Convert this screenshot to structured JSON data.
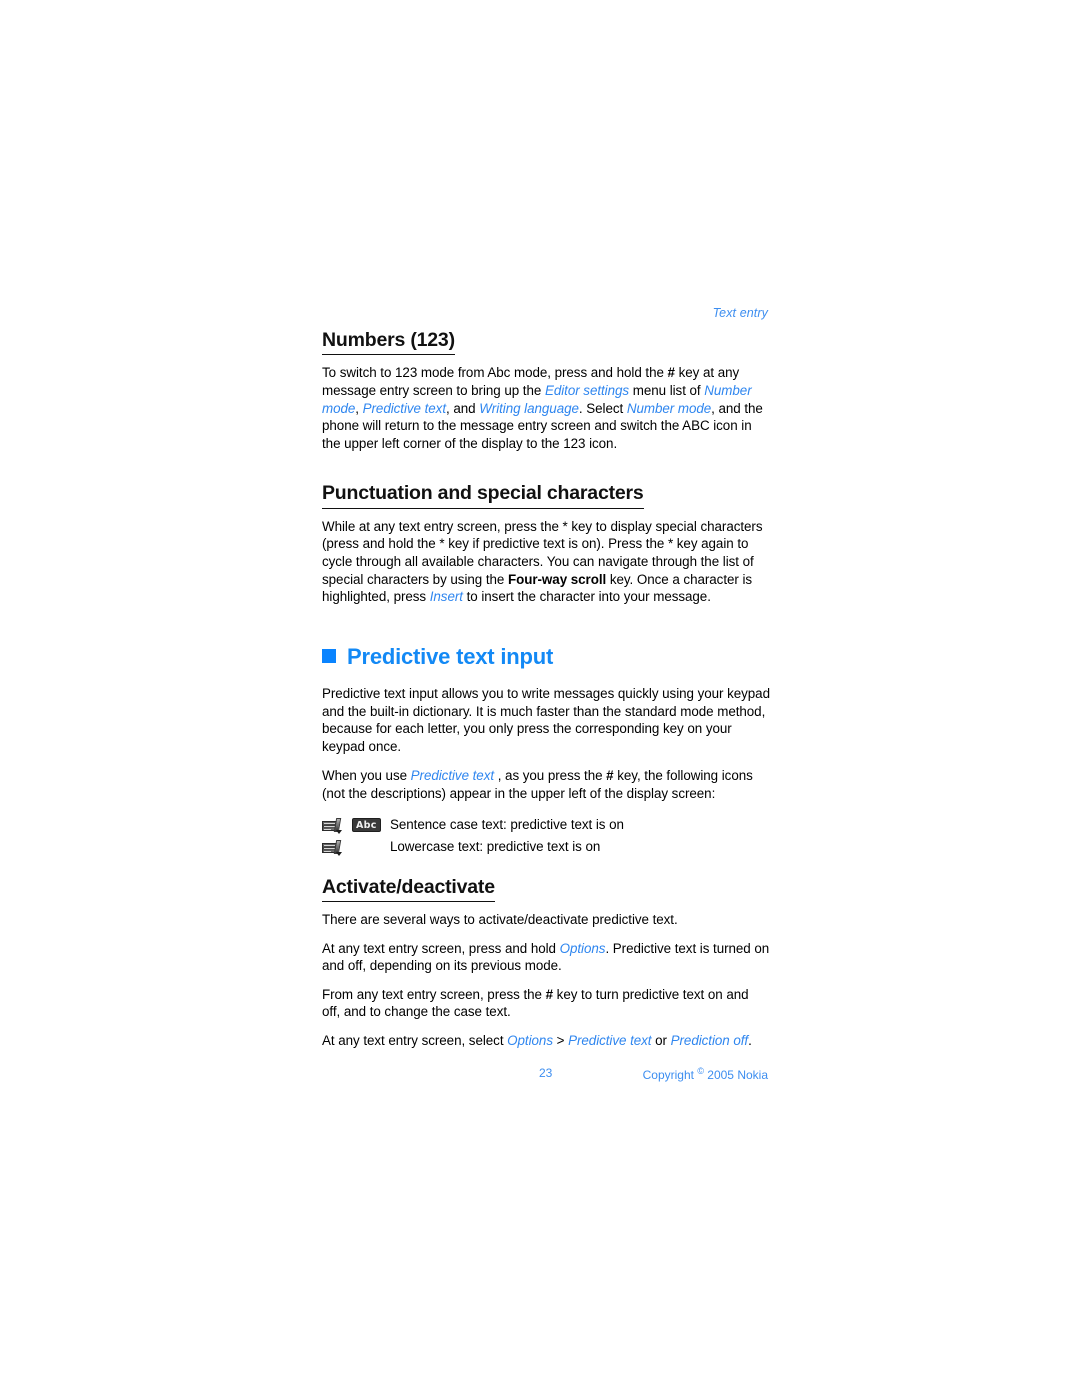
{
  "running_head": "Text entry",
  "sections": [
    {
      "id": "numbers",
      "heading": "Numbers (123)",
      "paragraph_parts": [
        {
          "t": "To switch to 123 mode from Abc mode, press and hold the ",
          "s": "normal"
        },
        {
          "t": "#",
          "s": "bold"
        },
        {
          "t": " key at any message entry screen to bring up the ",
          "s": "normal"
        },
        {
          "t": "Editor settings",
          "s": "link"
        },
        {
          "t": " menu list of ",
          "s": "normal"
        },
        {
          "t": "Number mode",
          "s": "link"
        },
        {
          "t": ", ",
          "s": "normal"
        },
        {
          "t": "Predictive text",
          "s": "link"
        },
        {
          "t": ", and ",
          "s": "normal"
        },
        {
          "t": "Writing language",
          "s": "link"
        },
        {
          "t": ". Select ",
          "s": "normal"
        },
        {
          "t": "Number mode",
          "s": "link"
        },
        {
          "t": ", and the phone will return to the message entry screen and switch the ABC icon in the upper left corner of the display to the 123 icon.",
          "s": "normal"
        }
      ]
    },
    {
      "id": "punctuation",
      "heading": "Punctuation and special characters",
      "paragraph_parts": [
        {
          "t": "While at any text entry screen, press the ",
          "s": "normal"
        },
        {
          "t": "*",
          "s": "normal"
        },
        {
          "t": " key to display special characters (press and hold the ",
          "s": "normal"
        },
        {
          "t": "*",
          "s": "normal"
        },
        {
          "t": " key if predictive text is on). Press the ",
          "s": "normal"
        },
        {
          "t": "*",
          "s": "normal"
        },
        {
          "t": " key again to cycle through all available characters. You can navigate through the list of special characters by using the ",
          "s": "normal"
        },
        {
          "t": "Four-way scroll",
          "s": "bold"
        },
        {
          "t": " key. Once a character is highlighted, press ",
          "s": "normal"
        },
        {
          "t": "Insert",
          "s": "link"
        },
        {
          "t": " to insert the character into your message.",
          "s": "normal"
        }
      ]
    }
  ],
  "chapter": {
    "bullet_icon": "blue-square-bullet",
    "title": "Predictive text input",
    "intro_paragraph": "Predictive text input allows you to write messages quickly using your keypad and the built-in dictionary. It is much faster than the standard mode method, because for each letter, you only press the corresponding key on your keypad once.",
    "icons_intro_parts": [
      {
        "t": "When you use ",
        "s": "normal"
      },
      {
        "t": "Predictive text",
        "s": "link"
      },
      {
        "t": " , as you press the ",
        "s": "normal"
      },
      {
        "t": "#",
        "s": "bold"
      },
      {
        "t": " key, the following icons (not the descriptions) appear in the upper left of the display screen:",
        "s": "normal"
      }
    ],
    "icon_legend": [
      {
        "predictive_icon": "predictive-text-icon",
        "case_badge": "Abc",
        "description": "Sentence case text: predictive text is on"
      },
      {
        "predictive_icon": "predictive-text-icon",
        "case_badge": "",
        "description": "Lowercase text: predictive text is on"
      }
    ]
  },
  "activate_section": {
    "heading": "Activate/deactivate",
    "p1": "There are several ways to activate/deactivate predictive text.",
    "p2_parts": [
      {
        "t": "At any text entry screen, press and hold ",
        "s": "normal"
      },
      {
        "t": "Options",
        "s": "link"
      },
      {
        "t": ". Predictive text is turned on and off, depending on its previous mode.",
        "s": "normal"
      }
    ],
    "p3_parts": [
      {
        "t": "From any text entry screen, press the ",
        "s": "normal"
      },
      {
        "t": "#",
        "s": "bold"
      },
      {
        "t": " key to turn predictive text on and off, and to change the case text.",
        "s": "normal"
      }
    ],
    "p4_parts": [
      {
        "t": "At any text entry screen, select ",
        "s": "normal"
      },
      {
        "t": "Options",
        "s": "link"
      },
      {
        "t": " > ",
        "s": "normal"
      },
      {
        "t": "Predictive text",
        "s": "link"
      },
      {
        "t": " or ",
        "s": "normal"
      },
      {
        "t": "Prediction off",
        "s": "link"
      },
      {
        "t": ".",
        "s": "normal"
      }
    ]
  },
  "footer": {
    "page_number": "23",
    "copyright_prefix": "Copyright ",
    "copyright_symbol": "©",
    "copyright_suffix": " 2005 Nokia"
  },
  "colors": {
    "link_blue": "#2f86ef",
    "heading_blue": "#1389f5",
    "bullet_blue": "#0a84ff",
    "running_head_blue": "#3d8ef0",
    "body_black": "#000000",
    "page_background": "#ffffff"
  }
}
